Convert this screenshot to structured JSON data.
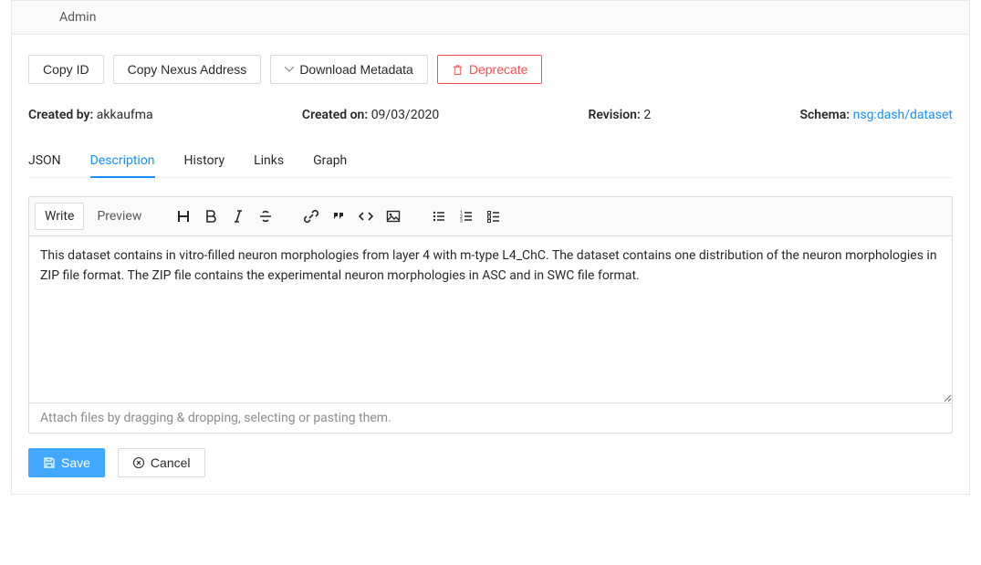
{
  "header": {
    "admin_label": "Admin"
  },
  "actions": {
    "copy_id": "Copy ID",
    "copy_nexus": "Copy Nexus Address",
    "download_metadata": "Download Metadata",
    "deprecate": "Deprecate"
  },
  "meta": {
    "created_by_label": "Created by:",
    "created_by_value": "akkaufma",
    "created_on_label": "Created on:",
    "created_on_value": "09/03/2020",
    "revision_label": "Revision:",
    "revision_value": "2",
    "schema_label": "Schema:",
    "schema_value": "nsg:dash/dataset"
  },
  "tabs": {
    "json": "JSON",
    "description": "Description",
    "history": "History",
    "links": "Links",
    "graph": "Graph",
    "active": "description"
  },
  "editor": {
    "mode_write": "Write",
    "mode_preview": "Preview",
    "body": "This dataset contains in vitro-filled neuron morphologies from layer 4 with m-type L4_ChC. The dataset contains one distribution of the neuron morphologies in ZIP file format. The ZIP file contains the experimental neuron morphologies in ASC and in SWC file format.",
    "attach_hint": "Attach files by dragging & dropping, selecting or pasting them."
  },
  "bottom": {
    "save": "Save",
    "cancel": "Cancel"
  }
}
